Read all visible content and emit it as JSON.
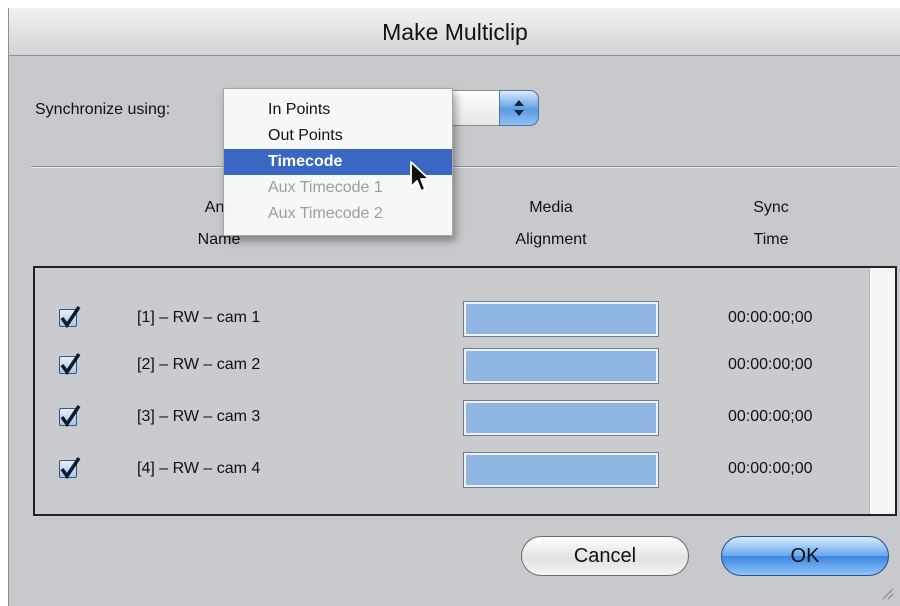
{
  "window": {
    "title": "Make Multiclip"
  },
  "sync": {
    "label": "Synchronize using:",
    "menu_items": [
      "In Points",
      "Out Points",
      "Timecode",
      "Aux Timecode 1",
      "Aux Timecode 2"
    ],
    "selected": "Timecode"
  },
  "columns": {
    "angle_top": "Ang",
    "angle_bottom": "Name",
    "media_top": "Media",
    "media_bottom": "Alignment",
    "sync_top": "Sync",
    "sync_bottom": "Time"
  },
  "rows": [
    {
      "name": "[1] – RW – cam 1",
      "sync_time": "00:00:00;00",
      "checked": true
    },
    {
      "name": "[2] – RW – cam 2",
      "sync_time": "00:00:00;00",
      "checked": true
    },
    {
      "name": "[3] – RW – cam 3",
      "sync_time": "00:00:00;00",
      "checked": true
    },
    {
      "name": "[4] – RW – cam 4",
      "sync_time": "00:00:00;00",
      "checked": true
    }
  ],
  "buttons": {
    "cancel": "Cancel",
    "ok": "OK"
  },
  "colors": {
    "accent": "#3a66c4",
    "window_bg": "#c7c9cc",
    "media_bar": "#8fb6e2"
  },
  "icons": {
    "checkbox": "checkmark-icon",
    "popup": "updown-arrows-icon",
    "cursor": "arrow-pointer-icon",
    "resize": "resize-grip-icon"
  }
}
